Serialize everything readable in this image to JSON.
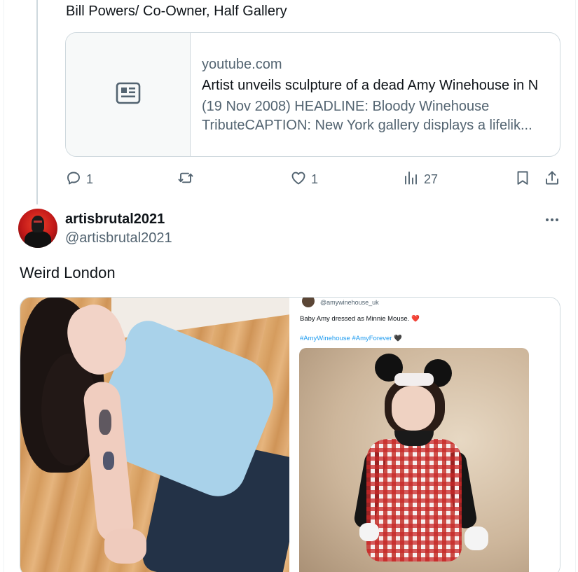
{
  "previous_post": {
    "text_tail": "Bill Powers/ Co-Owner, Half Gallery",
    "link_card": {
      "domain": "youtube.com",
      "title": "Artist unveils sculpture of a dead Amy Winehouse in N",
      "description_line1": "(19 Nov 2008) HEADLINE: Bloody Winehouse",
      "description_line2": "TributeCAPTION: New York gallery displays a lifelik...",
      "thumbnail_icon": "article-icon"
    },
    "actions": {
      "replies": "1",
      "reposts": "",
      "likes": "1",
      "views": "27"
    }
  },
  "post": {
    "display_name": "artisbrutal2021",
    "handle": "@artisbrutal2021",
    "text": "Weird London",
    "embedded_screenshot": {
      "handle": "@amywinehouse_uk",
      "text": "Baby Amy dressed as Minnie Mouse.",
      "heart": "❤️",
      "tags": "#AmyWinehouse #AmyForever",
      "black_heart": "🖤"
    }
  },
  "colors": {
    "text_primary": "#0f1419",
    "text_secondary": "#536471",
    "border": "#cfd9de",
    "link_blue": "#1d9bf0"
  }
}
